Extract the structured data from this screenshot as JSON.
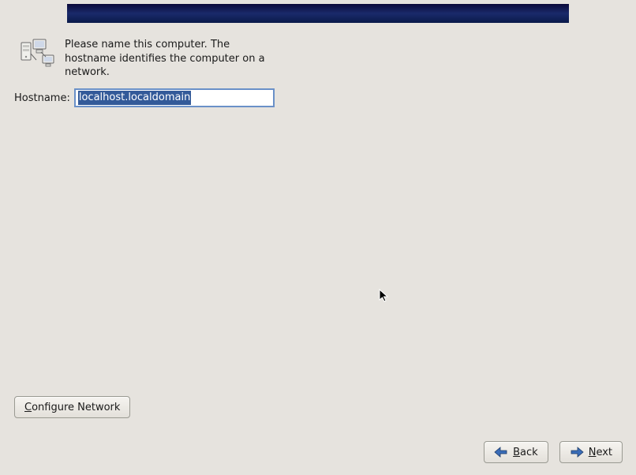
{
  "intro_text": "Please name this computer.  The hostname identifies the computer on a network.",
  "hostname": {
    "label": "Hostname:",
    "value": "localhost.localdomain"
  },
  "buttons": {
    "configure_prefix": "C",
    "configure_rest": "onfigure Network",
    "back_prefix": "B",
    "back_rest": "ack",
    "next_prefix": "N",
    "next_rest": "ext"
  }
}
